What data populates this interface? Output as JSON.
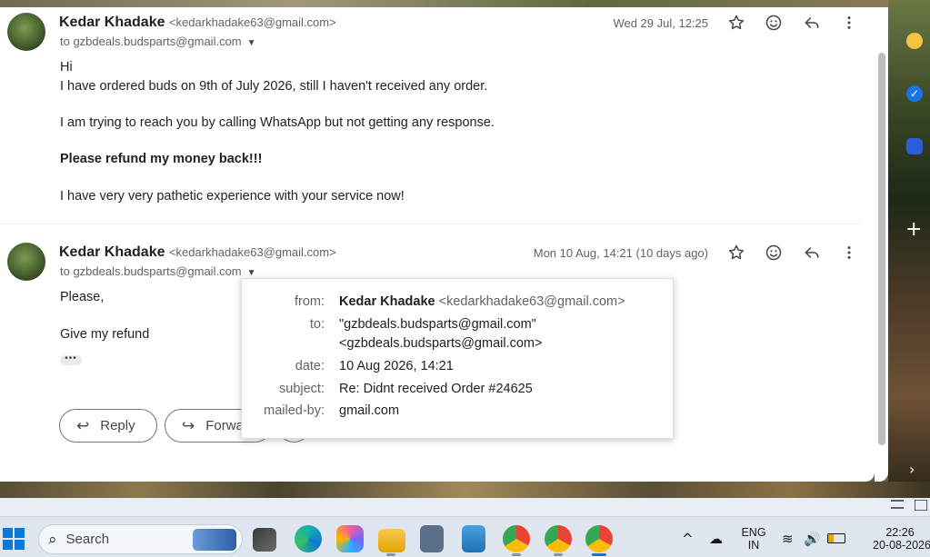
{
  "message1": {
    "sender_name": "Kedar Khadake",
    "sender_email": "<kedarkhadake63@gmail.com>",
    "to_line": "to gzbdeals.budsparts@gmail.com",
    "date": "Wed 29 Jul, 12:25",
    "body": [
      "Hi",
      "I have ordered buds on 9th of July 2026, still I haven't received any order.",
      "I am trying to reach you by calling WhatsApp but not getting any response.",
      "Please refund my money back!!!",
      "I have very very pathetic experience with your service now!"
    ]
  },
  "message2": {
    "sender_name": "Kedar Khadake",
    "sender_email": "<kedarkhadake63@gmail.com>",
    "to_line": "to gzbdeals.budsparts@gmail.com",
    "date": "Mon 10 Aug, 14:21 (10 days ago)",
    "body": [
      "Please,",
      "Give my refund"
    ],
    "ellipsis": "•••"
  },
  "details": {
    "from_label": "from:",
    "from_name": "Kedar Khadake",
    "from_email": "<kedarkhadake63@gmail.com>",
    "to_label": "to:",
    "to_value_1": "\"gzbdeals.budsparts@gmail.com\"",
    "to_value_2": "<gzbdeals.budsparts@gmail.com>",
    "date_label": "date:",
    "date_value": "10 Aug 2026, 14:21",
    "subject_label": "subject:",
    "subject_value": "Re: Didnt received Order #24625",
    "mailedby_label": "mailed-by:",
    "mailedby_value": "gmail.com"
  },
  "actions": {
    "reply_label": "Reply",
    "forward_label": "Forwa"
  },
  "taskbar": {
    "search_placeholder": "Search",
    "lang_1": "ENG",
    "lang_2": "IN",
    "time": "22:26",
    "date": "20-08-2026"
  },
  "colors": {
    "accent": "#0a78d7",
    "text_primary": "#202124",
    "text_secondary": "#5f6368"
  }
}
